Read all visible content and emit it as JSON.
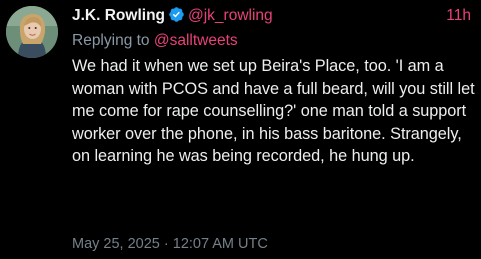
{
  "author": {
    "display_name": "J.K. Rowling",
    "handle": "@jk_rowling",
    "verified_icon": "verified-badge-icon",
    "avatar_icon": "profile-photo"
  },
  "tweet": {
    "relative_time": "11h",
    "reply_prefix": "Replying to ",
    "reply_handle": "@salltweets",
    "text": "We had it when we set up Beira's Place, too. 'I am a woman with PCOS and have a full beard, will you still let me come for rape counselling?' one man told a support worker over the phone, in his bass baritone. Strangely, on learning he was being recorded, he hung up.",
    "timestamp": "May 25, 2025 · 12:07 AM UTC"
  },
  "colors": {
    "background": "#000000",
    "text": "#e7e9ea",
    "accent_pink": "#e8417a",
    "verified_blue": "#1d9bf0",
    "muted": "#75808a"
  }
}
